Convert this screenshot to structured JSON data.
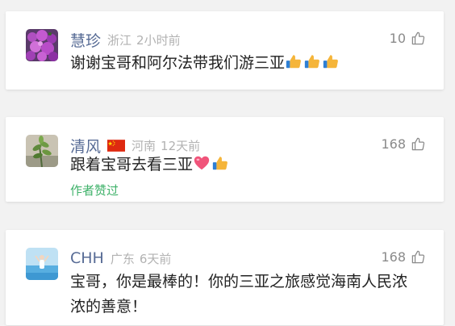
{
  "comments": [
    {
      "name": "慧珍",
      "location": "浙江",
      "time": "2小时前",
      "likes": "10",
      "text": "谢谢宝哥和阿尔法带我们游三亚",
      "emojis": [
        "thumbs-up-emoji",
        "thumbs-up-emoji",
        "thumbs-up-emoji"
      ],
      "author_liked": ""
    },
    {
      "name": "清风",
      "location": "河南",
      "time": "12天前",
      "likes": "168",
      "text": "跟着宝哥去看三亚",
      "emojis": [
        "heart-emoji",
        "thumbs-up-emoji"
      ],
      "author_liked": "作者赞过"
    },
    {
      "name": "CHH",
      "location": "广东",
      "time": "6天前",
      "likes": "168",
      "text": "宝哥，你是最棒的！你的三亚之旅感觉海南人民浓浓的善意！",
      "emojis": [],
      "author_liked": ""
    }
  ],
  "colors": {
    "name": "#576b95",
    "meta": "#b2b2b2",
    "author_liked": "#3fb26a",
    "background": "#f2f2f2"
  },
  "icons": {
    "like": "thumb-up-outline-icon",
    "flag": "china-flag-icon"
  }
}
